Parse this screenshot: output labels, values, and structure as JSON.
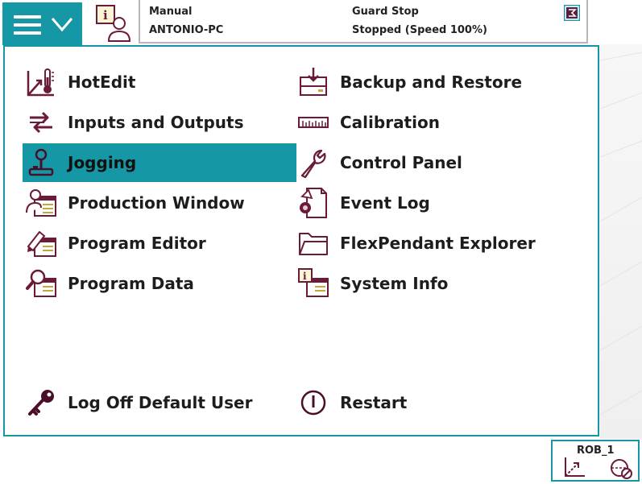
{
  "status": {
    "mode": "Manual",
    "controller": "ANTONIO-PC",
    "state": "Guard Stop",
    "speed_status": "Stopped (Speed 100%)"
  },
  "menu": {
    "left_items": [
      {
        "label": "HotEdit",
        "icon": "hotedit-icon"
      },
      {
        "label": "Inputs and Outputs",
        "icon": "io-arrows-icon"
      },
      {
        "label": "Jogging",
        "icon": "joystick-icon",
        "selected": true
      },
      {
        "label": "Production Window",
        "icon": "production-window-icon"
      },
      {
        "label": "Program Editor",
        "icon": "program-editor-icon"
      },
      {
        "label": "Program Data",
        "icon": "program-data-icon"
      }
    ],
    "right_items": [
      {
        "label": "Backup and Restore",
        "icon": "backup-icon"
      },
      {
        "label": "Calibration",
        "icon": "calibration-ruler-icon"
      },
      {
        "label": "Control Panel",
        "icon": "wrench-icon"
      },
      {
        "label": "Event Log",
        "icon": "event-log-icon"
      },
      {
        "label": "FlexPendant Explorer",
        "icon": "folder-icon"
      },
      {
        "label": "System Info",
        "icon": "system-info-icon"
      }
    ],
    "log_off": "Log Off Default User",
    "restart": "Restart"
  },
  "robot": {
    "label": "ROB_1"
  },
  "colors": {
    "accent": "#1597a6",
    "icon": "#6b1a3a",
    "text": "#1d1d1d"
  }
}
